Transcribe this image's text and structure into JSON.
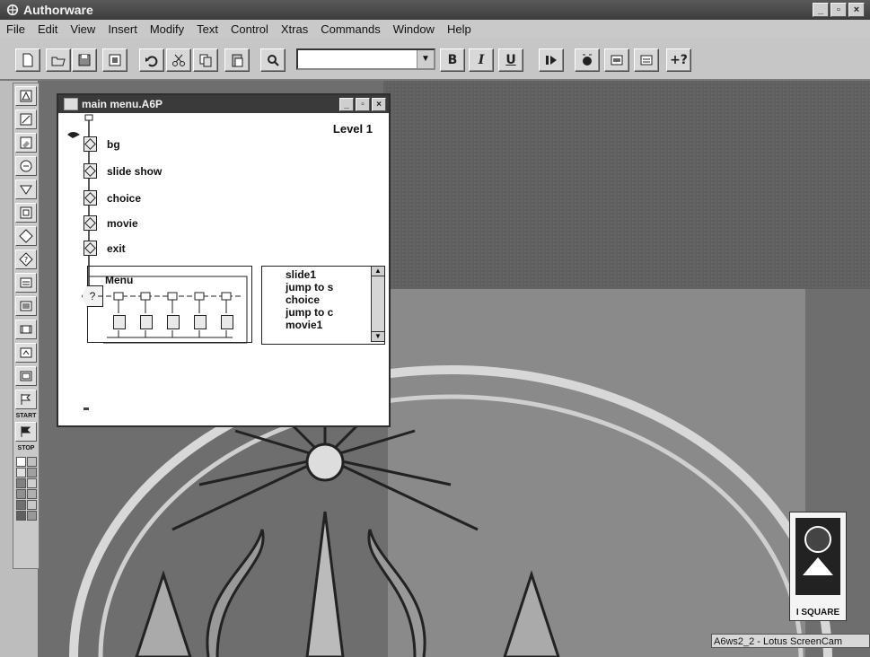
{
  "window": {
    "title": "Authorware"
  },
  "menubar": {
    "items": [
      "File",
      "Edit",
      "View",
      "Insert",
      "Modify",
      "Text",
      "Control",
      "Xtras",
      "Commands",
      "Window",
      "Help"
    ]
  },
  "toolbar": {
    "buttons": [
      "new-icon",
      "open-icon",
      "save-all-icon",
      "import-icon",
      "undo-icon",
      "cut-icon",
      "copy-icon",
      "paste-icon",
      "find-icon"
    ],
    "style_combo_value": "",
    "bold_label": "B",
    "italic_label": "I",
    "underline_label": "U",
    "help_label": "+?"
  },
  "palette": {
    "start_label": "START",
    "stop_label": "STOP",
    "colors": [
      "#ffffff",
      "#c0c0c0",
      "#e0e0e0",
      "#a0a0a0",
      "#808080",
      "#d0d0d0",
      "#909090",
      "#b0b0b0",
      "#707070",
      "#c8c8c8",
      "#606060",
      "#989898"
    ]
  },
  "flowline": {
    "title": "main menu.A6P",
    "level": "Level 1",
    "icons": [
      "bg",
      "slide show",
      "choice",
      "movie",
      "exit"
    ],
    "interaction_title": "Menu",
    "list_items": [
      "slide1",
      "jump to s",
      "choice",
      "jump to c",
      "movie1"
    ]
  },
  "screencam": {
    "badge": "I SQUARE",
    "status": "A6ws2_2 - Lotus ScreenCam"
  },
  "colors": {
    "titlebar": "#3c3c3c",
    "workspace": "#6e6e6e",
    "window_bg": "#ffffff"
  }
}
